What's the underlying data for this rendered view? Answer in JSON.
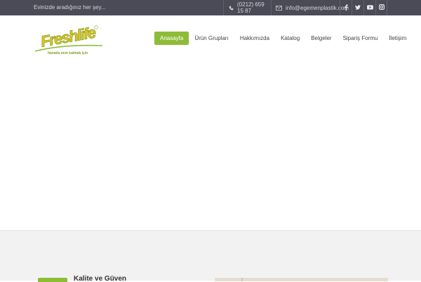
{
  "topbar": {
    "tagline": "Evinizde aradığınız her şey...",
    "phone": "(0212) 659 15 87",
    "email": "info@egemenplastik.com",
    "social": [
      {
        "icon": "facebook-icon"
      },
      {
        "icon": "twitter-icon"
      },
      {
        "icon": "youtube-icon"
      },
      {
        "icon": "instagram-icon"
      }
    ]
  },
  "logo": {
    "brand": "Freshlife",
    "slogan": "havada nem kalmak için"
  },
  "nav": {
    "items": [
      {
        "label": "Anasayfa",
        "active": true
      },
      {
        "label": "Ürün Grupları"
      },
      {
        "label": "Hakkımızda"
      },
      {
        "label": "Katalog"
      },
      {
        "label": "Belgeler"
      },
      {
        "label": "Sipariş Formu"
      },
      {
        "label": "İletişim"
      }
    ]
  },
  "feature": {
    "title": "Kalite ve Güven"
  },
  "colors": {
    "accent": "#8dbc37",
    "topbar": "#4a4b57",
    "logo_text": "#f0c419"
  }
}
